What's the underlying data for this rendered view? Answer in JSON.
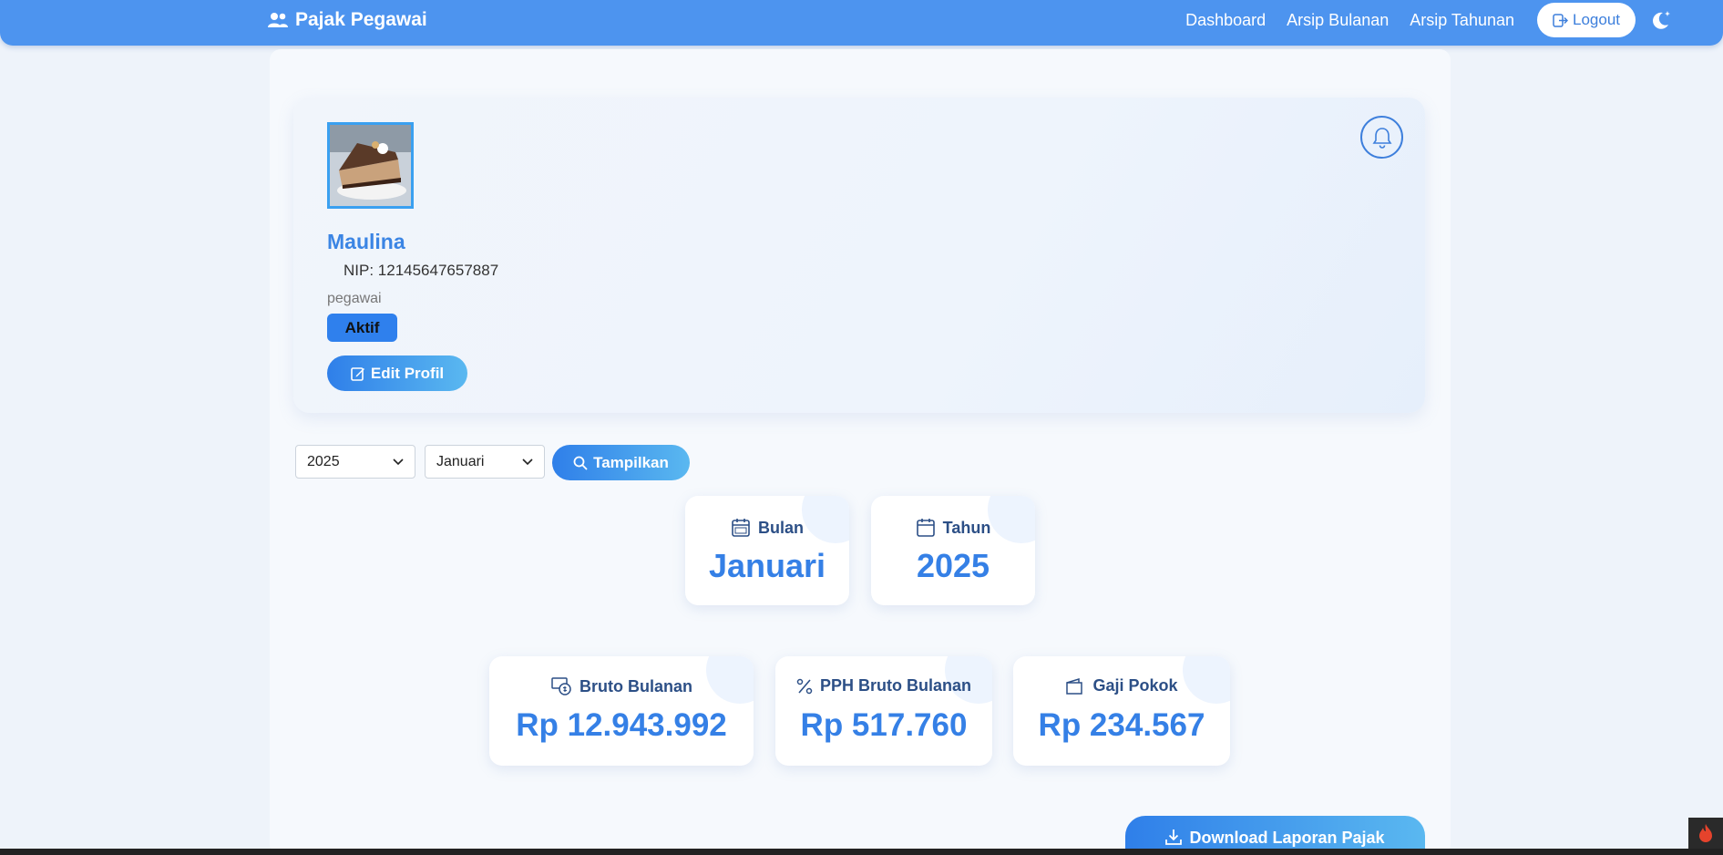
{
  "navbar": {
    "brand": "Pajak Pegawai",
    "links": [
      "Dashboard",
      "Arsip Bulanan",
      "Arsip Tahunan"
    ],
    "logout": "Logout"
  },
  "profile": {
    "name": "Maulina",
    "nip": "NIP: 12145647657887",
    "role": "pegawai",
    "status": "Aktif",
    "edit_label": "Edit Profil"
  },
  "filter": {
    "year": "2025",
    "month": "Januari",
    "search_label": "Tampilkan"
  },
  "period": {
    "month_label": "Bulan",
    "month_value": "Januari",
    "year_label": "Tahun",
    "year_value": "2025"
  },
  "summary": {
    "bruto_label": "Bruto Bulanan",
    "bruto_value": "Rp 12.943.992",
    "pph_label": "PPH Bruto Bulanan",
    "pph_value": "Rp 517.760",
    "gaji_label": "Gaji Pokok",
    "gaji_value": "Rp 234.567"
  },
  "download_label": "Download Laporan Pajak",
  "colors": {
    "primary": "#4d94ef",
    "accent": "#3580e6",
    "heading": "#2c4f86"
  }
}
